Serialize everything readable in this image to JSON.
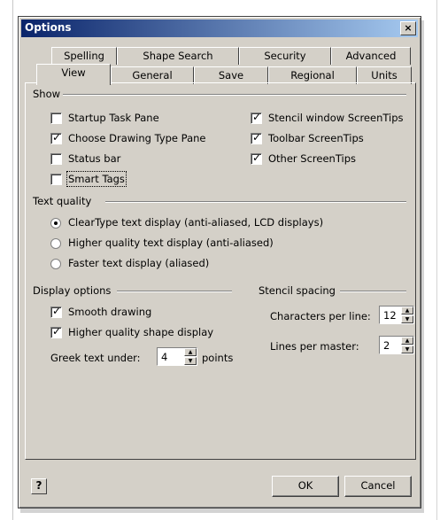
{
  "window": {
    "title": "Options",
    "close_glyph": "×"
  },
  "tabs": {
    "row1": [
      "Spelling",
      "Shape Search",
      "Security",
      "Advanced"
    ],
    "row2": [
      "View",
      "General",
      "Save",
      "Regional",
      "Units"
    ],
    "active": "View"
  },
  "show": {
    "label": "Show",
    "left": [
      {
        "label": "Startup Task Pane",
        "checked": false
      },
      {
        "label": "Choose Drawing Type Pane",
        "checked": true
      },
      {
        "label": "Status bar",
        "checked": false
      },
      {
        "label": "Smart Tags",
        "checked": false
      }
    ],
    "right": [
      {
        "label": "Stencil window ScreenTips",
        "checked": true
      },
      {
        "label": "Toolbar ScreenTips",
        "checked": true
      },
      {
        "label": "Other ScreenTips",
        "checked": true
      }
    ]
  },
  "text_quality": {
    "label": "Text quality",
    "options": [
      {
        "label": "ClearType text display (anti-aliased, LCD displays)",
        "selected": true
      },
      {
        "label": "Higher quality text display (anti-aliased)",
        "selected": false
      },
      {
        "label": "Faster text display (aliased)",
        "selected": false
      }
    ]
  },
  "display_options": {
    "label": "Display options",
    "items": [
      {
        "label": "Smooth drawing",
        "checked": true
      },
      {
        "label": "Higher quality shape display",
        "checked": true
      }
    ],
    "greek_label": "Greek text under:",
    "greek_value": "4",
    "greek_unit": "points"
  },
  "stencil_spacing": {
    "label": "Stencil spacing",
    "chars_label": "Characters per line:",
    "chars_value": "12",
    "lines_label": "Lines per master:",
    "lines_value": "2"
  },
  "footer": {
    "help_glyph": "?",
    "ok": "OK",
    "cancel": "Cancel"
  },
  "glyphs": {
    "check": "✓",
    "up": "▲",
    "down": "▼"
  }
}
